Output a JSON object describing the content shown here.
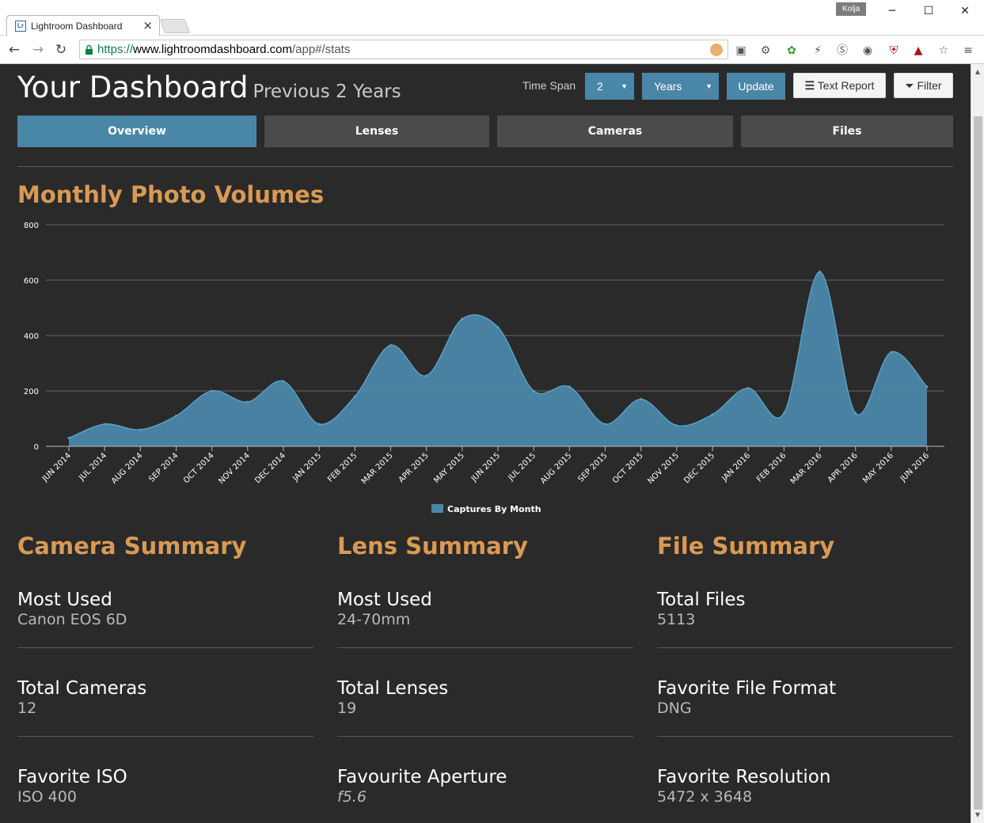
{
  "browser": {
    "tab_title": "Lightroom Dashboard",
    "profile_name": "Kolja",
    "url_protocol": "https://",
    "url_host": "www.lightroomdashboard.com",
    "url_path": "/app#/stats"
  },
  "header": {
    "title": "Your Dashboard",
    "subtitle": "Previous 2 Years",
    "time_span_label": "Time Span",
    "span_value": "2",
    "span_unit": "Years",
    "update_label": "Update",
    "text_report_label": "Text Report",
    "filter_label": "Filter"
  },
  "tabs": [
    {
      "label": "Overview",
      "active": true
    },
    {
      "label": "Lenses",
      "active": false
    },
    {
      "label": "Cameras",
      "active": false
    },
    {
      "label": "Files",
      "active": false
    }
  ],
  "chart_section_title": "Monthly Photo Volumes",
  "chart_data": {
    "type": "area",
    "title": "Monthly Photo Volumes",
    "x": [
      "JUN 2014",
      "JUL 2014",
      "AUG 2014",
      "SEP 2014",
      "OCT 2014",
      "NOV 2014",
      "DEC 2014",
      "JAN 2015",
      "FEB 2015",
      "MAR 2015",
      "APR 2015",
      "MAY 2015",
      "JUN 2015",
      "JUL 2015",
      "AUG 2015",
      "SEP 2015",
      "OCT 2015",
      "NOV 2015",
      "DEC 2015",
      "JAN 2016",
      "FEB 2016",
      "MAR 2016",
      "APR 2016",
      "MAY 2016",
      "JUN 2016"
    ],
    "series": [
      {
        "name": "Captures By Month",
        "values": [
          30,
          80,
          60,
          110,
          200,
          160,
          235,
          80,
          180,
          365,
          255,
          460,
          430,
          200,
          215,
          80,
          170,
          75,
          115,
          210,
          120,
          630,
          120,
          340,
          215
        ],
        "color": "#4a86a8"
      }
    ],
    "ylim": [
      0,
      800
    ],
    "yticks": [
      0,
      200,
      400,
      600,
      800
    ],
    "grid": true,
    "legend": "bottom"
  },
  "summaries": [
    {
      "title": "Camera Summary",
      "stats": [
        {
          "label": "Most Used",
          "value": "Canon EOS 6D"
        },
        {
          "label": "Total Cameras",
          "value": "12"
        },
        {
          "label": "Favorite ISO",
          "value": "ISO 400"
        }
      ]
    },
    {
      "title": "Lens Summary",
      "stats": [
        {
          "label": "Most Used",
          "value": "24-70mm"
        },
        {
          "label": "Total Lenses",
          "value": "19"
        },
        {
          "label": "Favourite Aperture",
          "value": "f5.6"
        }
      ]
    },
    {
      "title": "File Summary",
      "stats": [
        {
          "label": "Total Files",
          "value": "5113"
        },
        {
          "label": "Favorite File Format",
          "value": "DNG"
        },
        {
          "label": "Favorite Resolution",
          "value": "5472 x 3648"
        }
      ]
    }
  ]
}
